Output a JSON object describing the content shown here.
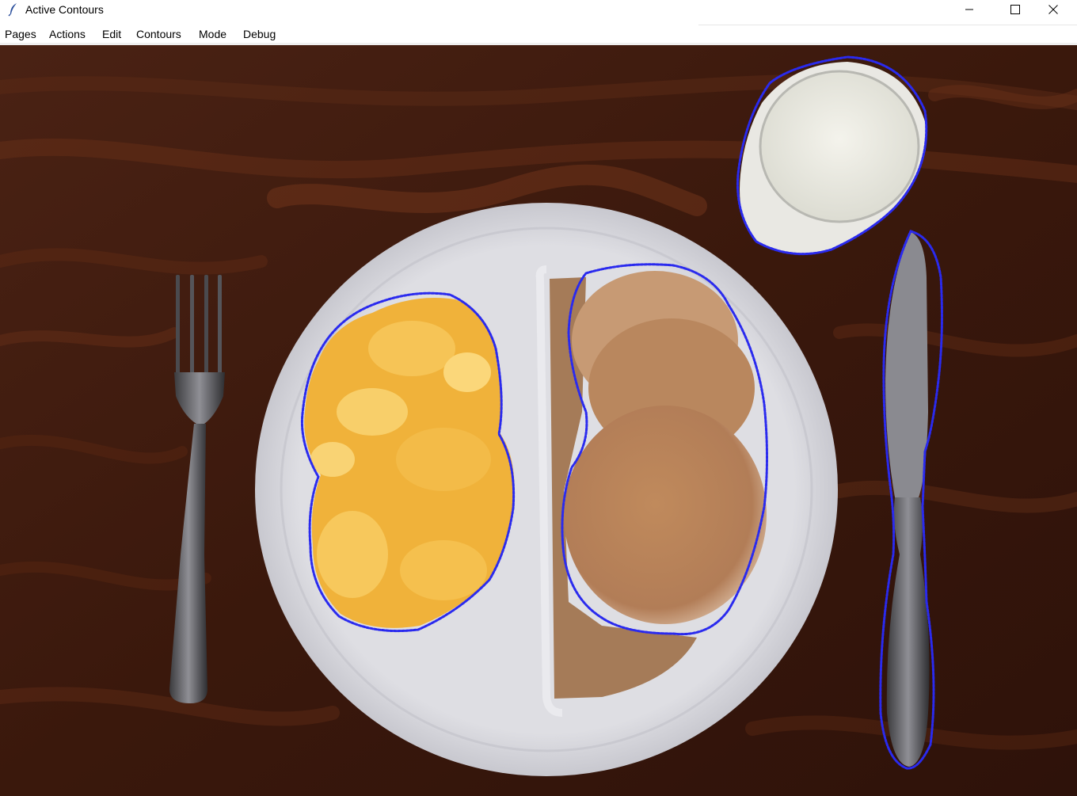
{
  "window": {
    "title": "Active Contours",
    "app_icon": "feather-icon",
    "controls": [
      "minimize-icon",
      "maximize-icon",
      "close-icon"
    ]
  },
  "menu": {
    "items": [
      "Pages",
      "Actions",
      "Edit",
      "Contours",
      "Mode",
      "Debug"
    ]
  },
  "canvas": {
    "contour_color": "#2a2aee",
    "table_color": "#3b1a0e",
    "plate_color": "#d7d7dd",
    "contours": [
      "eggs-contour",
      "pancakes-contour",
      "glass-contour",
      "knife-contour"
    ]
  }
}
